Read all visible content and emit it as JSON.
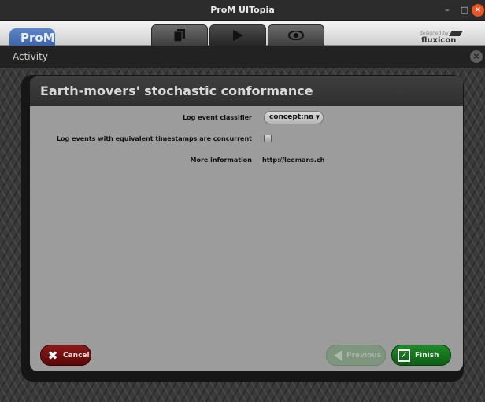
{
  "window": {
    "title": "ProM UITopia",
    "minimize": "–",
    "maximize": "□",
    "close": "×"
  },
  "toolbar": {
    "logo": "ProM",
    "tabs": [
      {
        "name": "workspace",
        "icon": "document-stack-icon",
        "glyph": "▮"
      },
      {
        "name": "actions",
        "icon": "play-icon",
        "glyph": "▶"
      },
      {
        "name": "views",
        "icon": "eye-icon",
        "glyph": "◉"
      }
    ],
    "brand_prefix": "designed by",
    "brand_name": "fluxicon"
  },
  "activity": {
    "label": "Activity",
    "close": "×"
  },
  "dialog": {
    "title": "Earth-movers' stochastic conformance",
    "fields": {
      "classifier_label": "Log event classifier",
      "classifier_value": "concept:na",
      "concurrent_label": "Log events with equivalent timestamps are concurrent",
      "concurrent_checked": false,
      "info_label": "More information",
      "info_value": "http://leemans.ch"
    },
    "buttons": {
      "cancel": "Cancel",
      "previous": "Previous",
      "finish": "Finish"
    }
  },
  "colors": {
    "cancel": "#7a1010",
    "finish": "#1a7a22",
    "previous_disabled": "#7e957e",
    "dialog_bg": "#9c9c9c"
  }
}
